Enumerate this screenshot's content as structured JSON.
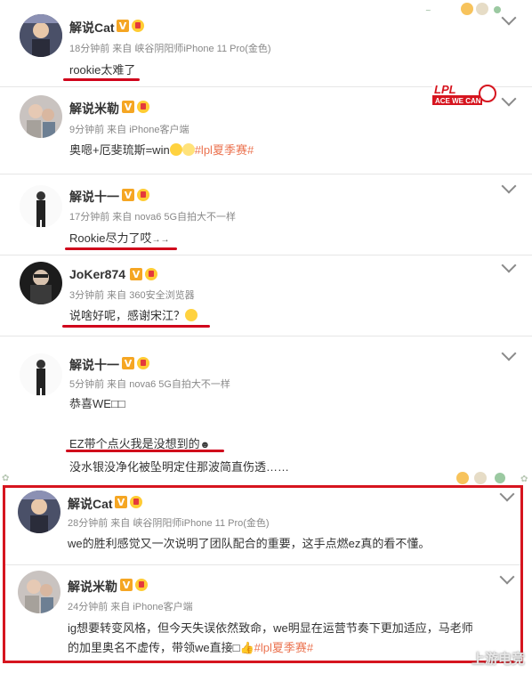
{
  "posts": [
    {
      "name": "解说Cat",
      "meta": "18分钟前 来自 峡谷阴阳师iPhone 11 Pro(金色)",
      "text": "rookie太难了"
    },
    {
      "name": "解说米勒",
      "meta": "9分钟前 来自 iPhone客户端",
      "text": "奥嗯+厄斐琉斯=win",
      "topic": "#lpl夏季赛#"
    },
    {
      "name": "解说十一",
      "meta": "17分钟前 来自 nova6 5G自拍大不一样",
      "text": "Rookie尽力了哎",
      "arrows": "→→"
    },
    {
      "name": "JoKer874",
      "meta": "3分钟前 来自 360安全浏览器",
      "text": "说啥好呢，感谢宋江？"
    },
    {
      "name": "解说十一",
      "meta": "5分钟前 来自 nova6 5G自拍大不一样",
      "text": "恭喜WE□□",
      "line2": "EZ带个点火我是没想到的",
      "line3": "没水银没净化被坠明定住那波简直伤透……"
    },
    {
      "name": "解说Cat",
      "meta": "28分钟前 来自 峡谷阴阳师iPhone 11 Pro(金色)",
      "text": "we的胜利感觉又一次说明了团队配合的重要，这手点燃ez真的看不懂。"
    },
    {
      "name": "解说米勒",
      "meta": "24分钟前 来自 iPhone客户端",
      "text": "ig想要转变风格，但今天失误依然致命，we明显在运营节奏下更加适应，马老师",
      "line2": "的加里奥名不虚传，带领we直接□",
      "topic": "#lpl夏季赛#"
    }
  ],
  "vbadge": "V",
  "lpl_logo": "LPL",
  "lpl_sub": "ACE WE CAN",
  "watermark": "上游电竞",
  "colors": {
    "accent": "#eb7350",
    "highlight": "#d6151f"
  }
}
